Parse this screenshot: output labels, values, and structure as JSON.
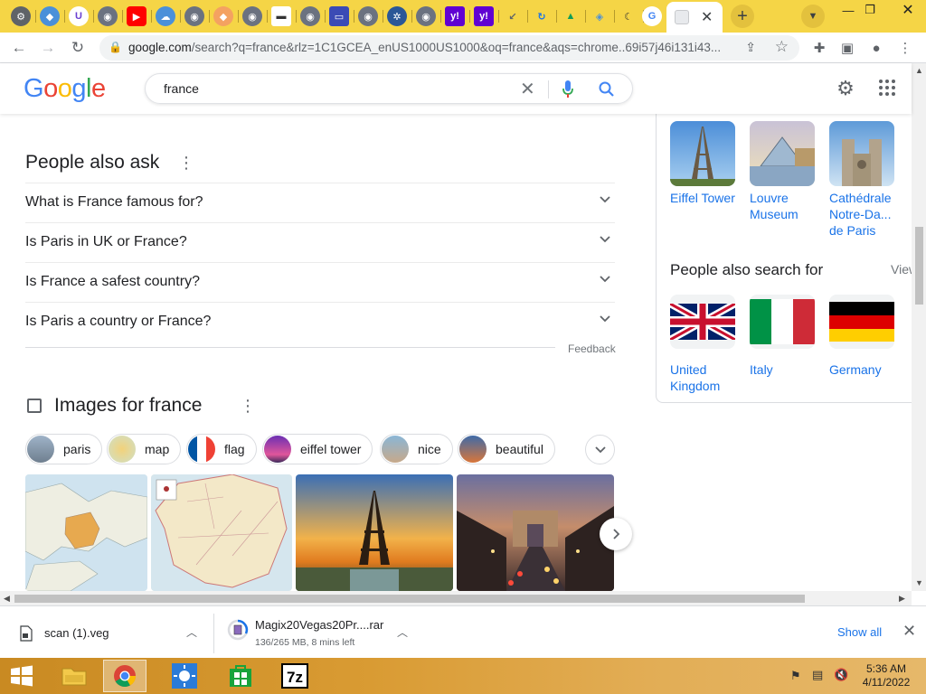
{
  "browser": {
    "address": {
      "host": "google.com",
      "path": "/search?q=france&rlz=1C1GCEA_enUS1000US1000&oq=france&aqs=chrome..69i57j46i131i43..."
    },
    "active_tab_close": "✕",
    "new_tab": "+"
  },
  "google": {
    "logo": "Google",
    "query": "france"
  },
  "people_also_ask": {
    "title": "People also ask",
    "questions": [
      "What is France famous for?",
      "Is Paris in UK or France?",
      "Is France a safest country?",
      "Is Paris a country or France?"
    ],
    "feedback": "Feedback"
  },
  "images": {
    "title": "Images for france",
    "chips": [
      "paris",
      "map",
      "flag",
      "eiffel tower",
      "nice",
      "beautiful"
    ]
  },
  "knowledge_panel": {
    "landmarks": [
      {
        "name": "Eiffel Tower"
      },
      {
        "name": "Louvre Museum"
      },
      {
        "name": "Cathédrale Notre-Da... de Paris"
      }
    ],
    "people_also_search_for": {
      "title": "People also search for",
      "view": "View",
      "items": [
        {
          "name": "United Kingdom"
        },
        {
          "name": "Italy"
        },
        {
          "name": "Germany"
        }
      ]
    }
  },
  "downloads": {
    "items": [
      {
        "name": "scan (1).veg",
        "status": ""
      },
      {
        "name": "Magix20Vegas20Pr....rar",
        "status": "136/265 MB, 8 mins left"
      }
    ],
    "show_all": "Show all"
  },
  "taskbar": {
    "time": "5:36 AM",
    "date": "4/11/2022"
  },
  "colors": {
    "tabstrip": "#f5d546",
    "link": "#1a73e8",
    "taskbar": "#d99b33"
  }
}
